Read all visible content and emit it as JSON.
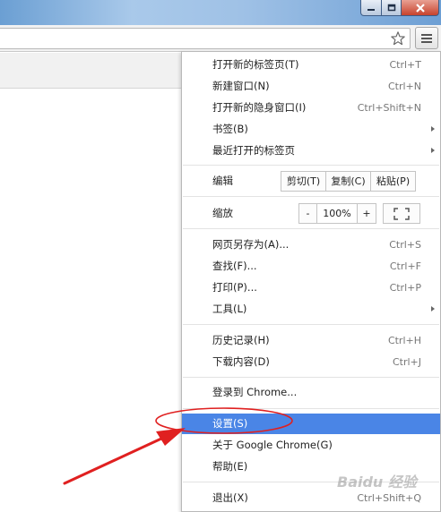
{
  "window": {
    "controls": [
      "minimize-icon",
      "maximize-icon",
      "close-icon"
    ]
  },
  "toolbar": {
    "bookmark_icon": "star-icon",
    "menu_icon": "hamburger-menu-icon"
  },
  "menu": {
    "new_tab": {
      "label": "打开新的标签页(T)",
      "shortcut": "Ctrl+T"
    },
    "new_window": {
      "label": "新建窗口(N)",
      "shortcut": "Ctrl+N"
    },
    "incognito": {
      "label": "打开新的隐身窗口(I)",
      "shortcut": "Ctrl+Shift+N"
    },
    "bookmarks": {
      "label": "书签(B)"
    },
    "recent_tabs": {
      "label": "最近打开的标签页"
    },
    "edit": {
      "label": "编辑",
      "cut": "剪切(T)",
      "copy": "复制(C)",
      "paste": "粘贴(P)"
    },
    "zoom": {
      "label": "缩放",
      "minus": "-",
      "value": "100%",
      "plus": "+"
    },
    "save_as": {
      "label": "网页另存为(A)...",
      "shortcut": "Ctrl+S"
    },
    "find": {
      "label": "查找(F)...",
      "shortcut": "Ctrl+F"
    },
    "print": {
      "label": "打印(P)...",
      "shortcut": "Ctrl+P"
    },
    "tools": {
      "label": "工具(L)"
    },
    "history": {
      "label": "历史记录(H)",
      "shortcut": "Ctrl+H"
    },
    "downloads": {
      "label": "下载内容(D)",
      "shortcut": "Ctrl+J"
    },
    "sign_in": {
      "label": "登录到 Chrome..."
    },
    "settings": {
      "label": "设置(S)"
    },
    "about": {
      "label": "关于 Google Chrome(G)"
    },
    "help": {
      "label": "帮助(E)"
    },
    "exit": {
      "label": "退出(X)",
      "shortcut": "Ctrl+Shift+Q"
    }
  },
  "annotation": {
    "color": "#e02020"
  },
  "watermark": {
    "text": "Baidu 经验"
  }
}
